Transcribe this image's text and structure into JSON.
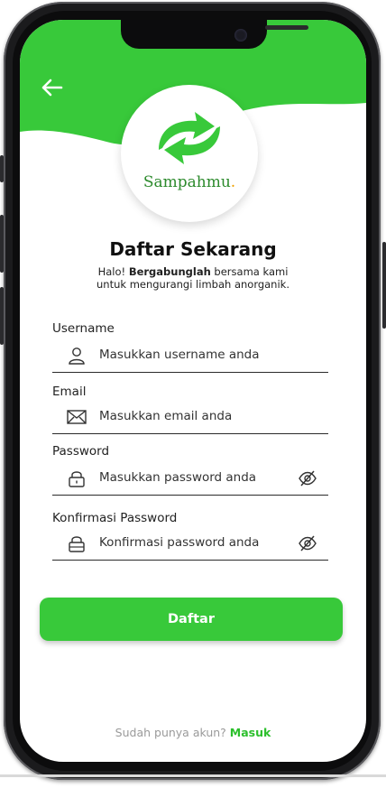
{
  "app": {
    "brand": "Sampahmu",
    "brand_dot": ".",
    "accent_color": "#38c93a",
    "brand_text_color": "#2c8a2c"
  },
  "header": {
    "back_icon": "arrow-left-icon",
    "title": "Daftar Sekarang"
  },
  "intro": {
    "prefix": "Halo! ",
    "bold": "Bergabunglah",
    "suffix": " bersama kami",
    "line2": "untuk mengurangi limbah anorganik."
  },
  "form": {
    "username": {
      "label": "Username",
      "placeholder": "Masukkan username anda",
      "icon": "user-icon"
    },
    "email": {
      "label": "Email",
      "placeholder": "Masukkan email anda",
      "icon": "mail-icon"
    },
    "password": {
      "label": "Password",
      "placeholder": "Masukkan password anda",
      "icon": "lock-icon",
      "toggle_icon": "eye-off-icon"
    },
    "confirm_password": {
      "label": "Konfirmasi Password",
      "placeholder": "Konfirmasi password anda",
      "icon": "lock-icon",
      "toggle_icon": "eye-off-icon"
    },
    "submit_label": "Daftar"
  },
  "footer": {
    "prompt": "Sudah punya akun?",
    "link": "Masuk"
  }
}
